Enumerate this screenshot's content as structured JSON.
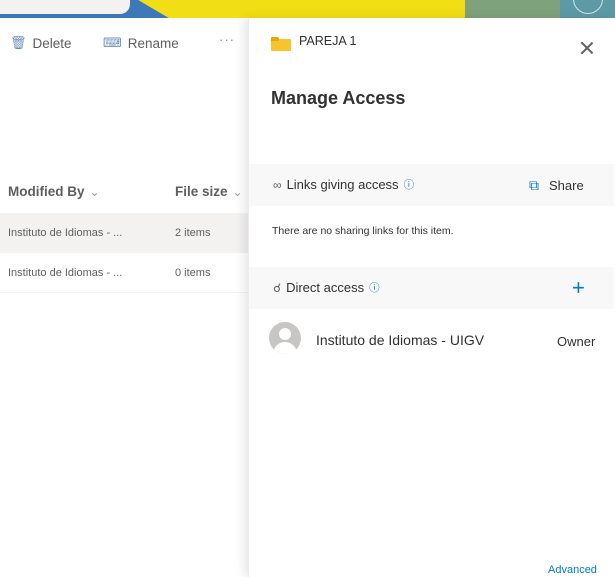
{
  "toolbar": {
    "delete_label": "Delete",
    "rename_label": "Rename",
    "more_label": "···"
  },
  "columns": {
    "modified_by": "Modified By",
    "file_size": "File size"
  },
  "rows": [
    {
      "modified_by": "Instituto de Idiomas - ...",
      "size": "2 items",
      "selected": true
    },
    {
      "modified_by": "Instituto de Idiomas - ...",
      "size": "0 items",
      "selected": false
    }
  ],
  "panel": {
    "folder_name": "PAREJA 1",
    "title": "Manage Access",
    "links_section": {
      "label": "Links giving access",
      "share_label": "Share",
      "empty_text": "There are no sharing links for this item."
    },
    "direct_section": {
      "label": "Direct access"
    },
    "users": [
      {
        "name": "Instituto de Idiomas - UIGV",
        "role": "Owner"
      }
    ],
    "advanced_label": "Advanced"
  },
  "icons": {
    "delete": "trash-icon",
    "rename": "rename-icon",
    "folder": "folder-icon",
    "close": "close-icon",
    "link": "link-icon",
    "info": "info-icon",
    "share": "share-icon",
    "people": "people-icon",
    "add": "plus-icon",
    "avatar": "avatar-icon"
  },
  "colors": {
    "accent": "#0078d4",
    "folder": "#f7c42d",
    "selected_row": "#f3f2f1",
    "section_bg": "#f8f8f8"
  }
}
